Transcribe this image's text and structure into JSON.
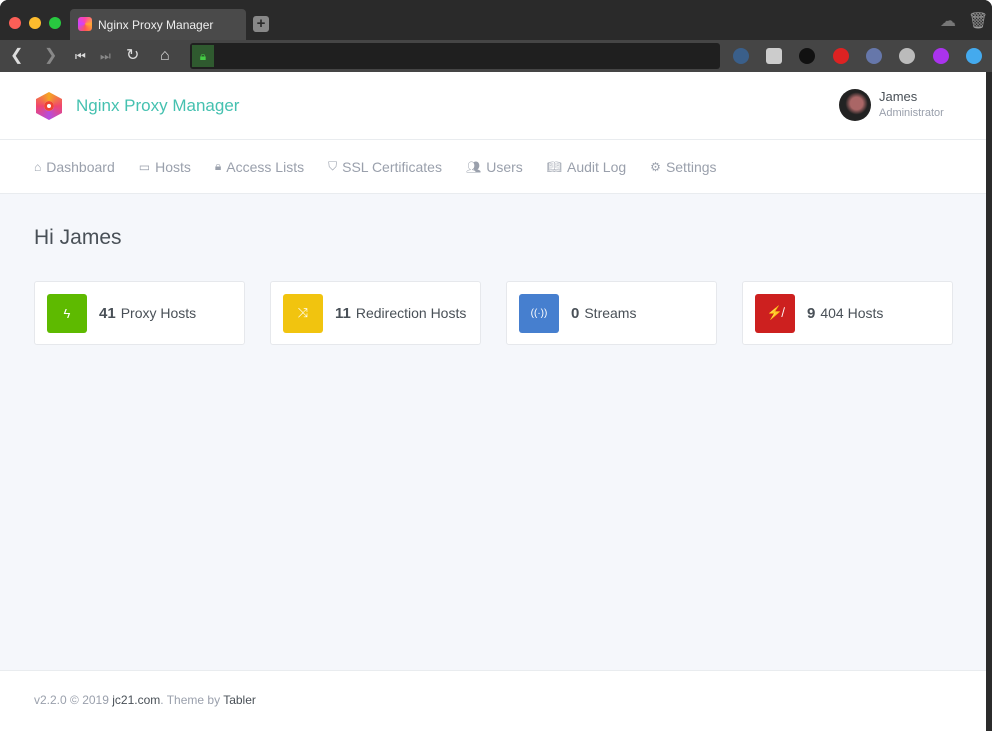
{
  "browser": {
    "tab_title": "Nginx Proxy Manager",
    "new_tab": "+"
  },
  "app": {
    "name": "Nginx Proxy Manager"
  },
  "user": {
    "name": "James",
    "role": "Administrator"
  },
  "nav": [
    {
      "label": "Dashboard",
      "icon": "⌂"
    },
    {
      "label": "Hosts",
      "icon": "▭"
    },
    {
      "label": "Access Lists",
      "icon": "🔒︎"
    },
    {
      "label": "SSL Certificates",
      "icon": "⛉"
    },
    {
      "label": "Users",
      "icon": "👥︎"
    },
    {
      "label": "Audit Log",
      "icon": "📖︎"
    },
    {
      "label": "Settings",
      "icon": "⚙"
    }
  ],
  "greeting": "Hi James",
  "cards": [
    {
      "count": "41",
      "label": "Proxy Hosts",
      "icon": "ϟ",
      "color": "#5eba00"
    },
    {
      "count": "11",
      "label": "Redirection Hosts",
      "icon": "⤨",
      "color": "#f1c40f"
    },
    {
      "count": "0",
      "label": "Streams",
      "icon": "((·))",
      "color": "#467fcf"
    },
    {
      "count": "9",
      "label": "404 Hosts",
      "icon": "⚡̸",
      "color": "#cd201f"
    }
  ],
  "footer": {
    "version": "v2.2.0 © 2019 ",
    "author": "jc21.com",
    "theme_text": ". Theme by ",
    "theme": "Tabler"
  }
}
